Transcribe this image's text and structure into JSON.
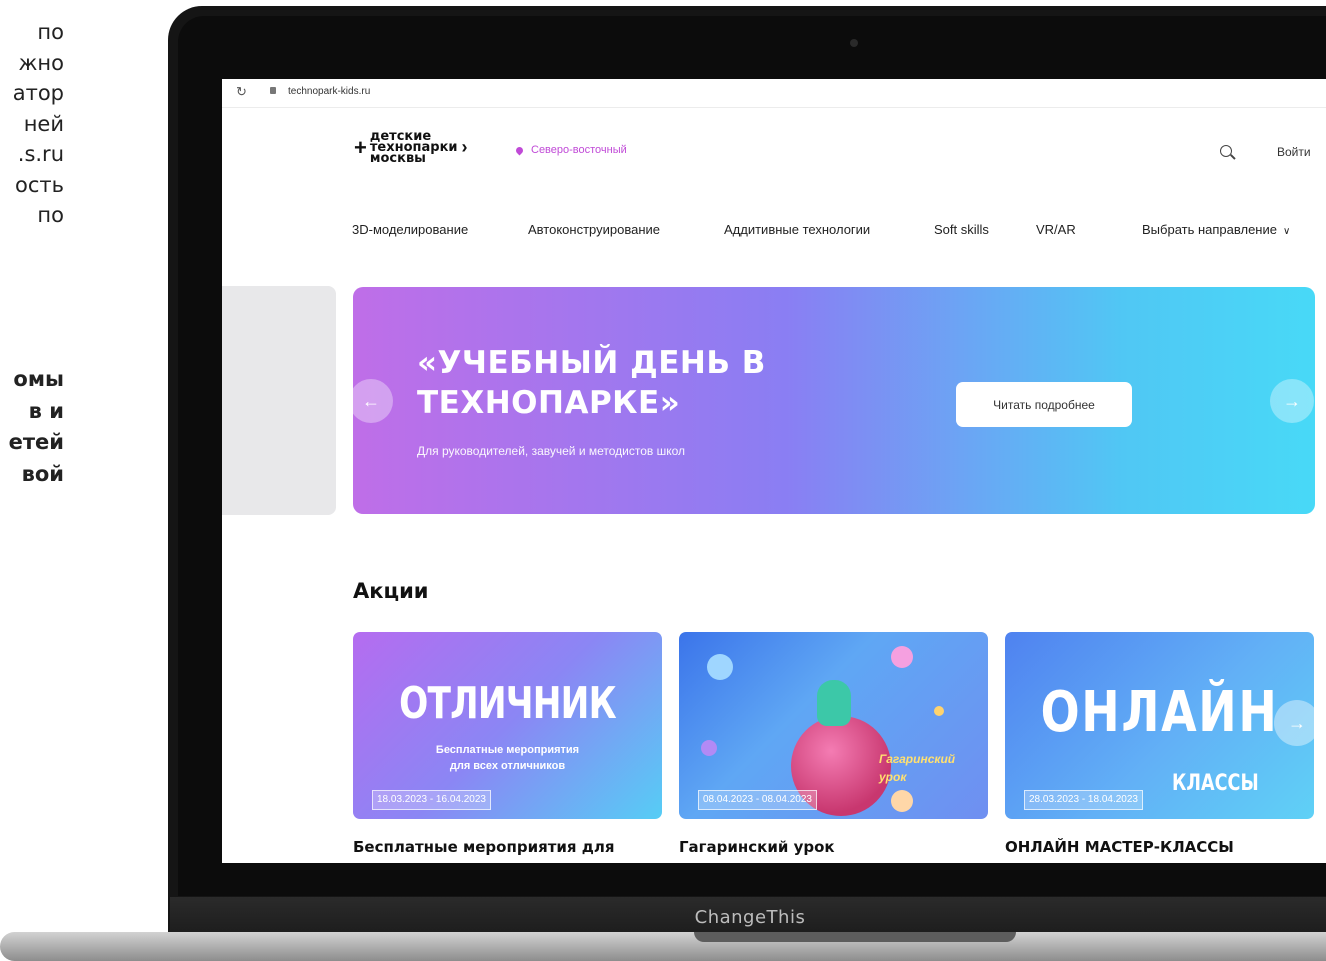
{
  "side_text": {
    "top_lines": [
      "по",
      "жно",
      "атор",
      "ней",
      "s.ru.",
      "ость",
      "по"
    ],
    "bold_lines": [
      "омы",
      "в и",
      "етей",
      "вой"
    ]
  },
  "laptop": {
    "label": "ChangeThis"
  },
  "browser": {
    "url": "technopark-kids.ru",
    "reload_icon": "reload-icon"
  },
  "header": {
    "logo_lines": [
      "детские",
      "технопарки",
      "москвы"
    ],
    "logo_plus": "+",
    "logo_chevron": "›",
    "region": "Северо-восточный",
    "login": "Войти"
  },
  "nav": {
    "items": [
      "3D-моделирование",
      "Автоконструирование",
      "Аддитивные технологии",
      "Soft skills",
      "VR/AR"
    ],
    "dropdown": "Выбрать направление"
  },
  "banner": {
    "title_line1": "«УЧЕБНЫЙ ДЕНЬ В",
    "title_line2": "ТЕХНОПАРКЕ»",
    "subtitle": "Для руководителей, завучей и методистов школ",
    "button": "Читать подробнее"
  },
  "promos": {
    "heading": "Акции",
    "cards": [
      {
        "art_title": "ОТЛИЧНИК",
        "art_sub1": "Бесплатные мероприятия",
        "art_sub2": "для всех отличников",
        "date": "18.03.2023 - 16.04.2023",
        "title": "Бесплатные мероприятия для"
      },
      {
        "art_title1": "Гагаринский",
        "art_title2": "урок",
        "date": "08.04.2023 - 08.04.2023",
        "title": "Гагаринский урок"
      },
      {
        "art_title": "ОНЛАЙН",
        "art_sub": "КЛАССЫ",
        "date": "28.03.2023 - 18.04.2023",
        "title": "ОНЛАЙН МАСТЕР-КЛАССЫ"
      }
    ]
  },
  "colors": {
    "accent": "#c04ad7",
    "banner_start": "#bf6ee8",
    "banner_end": "#48d9f7"
  }
}
